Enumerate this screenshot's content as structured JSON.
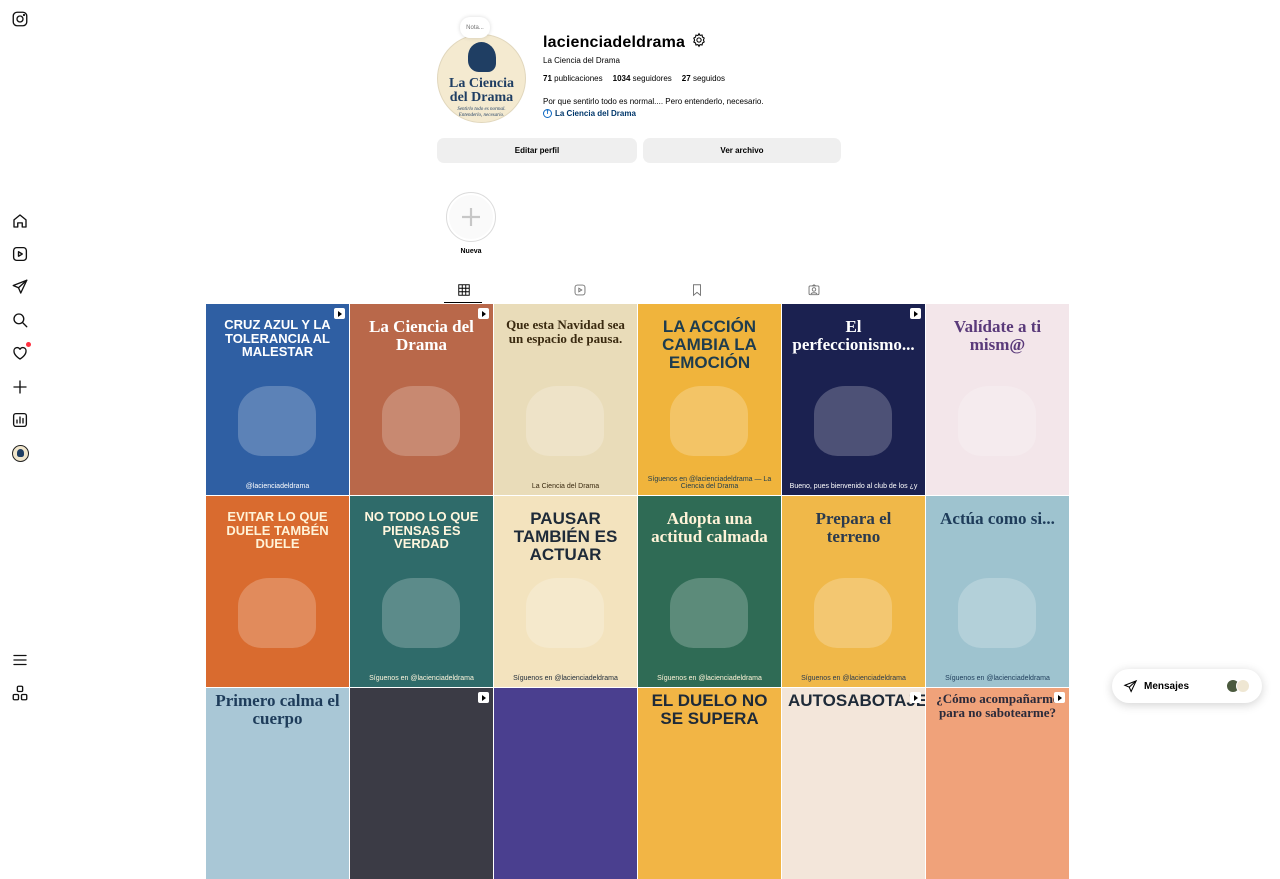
{
  "profile": {
    "note": "Nota...",
    "username": "lacienciadeldrama",
    "full_name": "La Ciencia del Drama",
    "stats": {
      "posts_count": "71",
      "posts_label": "publicaciones",
      "followers_count": "1034",
      "followers_label": "seguidores",
      "following_count": "27",
      "following_label": "seguidos"
    },
    "bio": "Por que sentirlo todo es normal.... Pero entenderlo, necesario.",
    "link_text": "La Ciencia del Drama",
    "avatar": {
      "line1": "La Ciencia",
      "line2": "del Drama",
      "tagline": "Sentirlo todo es normal. Entenderlo, necesario."
    },
    "edit_button": "Editar perfil",
    "archive_button": "Ver archivo"
  },
  "highlight": {
    "label": "Nueva"
  },
  "tabs": [
    "posts-grid-icon",
    "reels-icon",
    "saved-icon",
    "tagged-icon"
  ],
  "posts": [
    {
      "caption": "CRUZ AZUL Y LA TOLERANCIA AL MALESTAR",
      "footer": "@lacienciadeldrama",
      "bg": "#2f5fa3",
      "fg": "#ffffff",
      "reel": true
    },
    {
      "caption": "La Ciencia del Drama",
      "footer": "",
      "bg": "#b9684a",
      "fg": "#ffffff",
      "reel": true
    },
    {
      "caption": "Que esta Navidad sea un espacio de pausa.",
      "footer": "La Ciencia del Drama",
      "bg": "#e9dcb9",
      "fg": "#3a2a10",
      "reel": false
    },
    {
      "caption": "LA ACCIÓN CAMBIA LA EMOCIÓN",
      "footer": "Síguenos en @lacienciadeldrama — La Ciencia del Drama",
      "bg": "#f0b43c",
      "fg": "#1e3c4e",
      "reel": false
    },
    {
      "caption": "El perfeccionismo...",
      "footer": "Bueno, pues bienvenido al club de los ¿y",
      "bg": "#1b2150",
      "fg": "#ffffff",
      "reel": true
    },
    {
      "caption": "Valídate a ti mism@",
      "footer": "",
      "bg": "#f3e6ea",
      "fg": "#5a3a7a",
      "reel": false
    },
    {
      "caption": "EVITAR LO QUE DUELE TAMBÉN DUELE",
      "footer": "",
      "bg": "#d96b2f",
      "fg": "#fff3d8",
      "reel": false
    },
    {
      "caption": "NO TODO LO QUE PIENSAS ES VERDAD",
      "footer": "Síguenos en @lacienciadeldrama",
      "bg": "#2f6b6a",
      "fg": "#fff6dd",
      "reel": false
    },
    {
      "caption": "PAUSAR TAMBIÉN ES ACTUAR",
      "footer": "Síguenos en @lacienciadeldrama",
      "bg": "#f3e3be",
      "fg": "#1e2a38",
      "reel": false
    },
    {
      "caption": "Adopta una actitud calmada",
      "footer": "Síguenos en @lacienciadeldrama",
      "bg": "#2f6b55",
      "fg": "#fff3d8",
      "reel": false
    },
    {
      "caption": "Prepara el terreno",
      "footer": "Síguenos en @lacienciadeldrama",
      "bg": "#f0b849",
      "fg": "#2a3a4e",
      "reel": false
    },
    {
      "caption": "Actúa como si...",
      "footer": "Síguenos en @lacienciadeldrama",
      "bg": "#9ec3cf",
      "fg": "#1e3c5a",
      "reel": false
    },
    {
      "caption": "Primero calma el cuerpo",
      "footer": "",
      "bg": "#a9c7d6",
      "fg": "#1e3c5a",
      "reel": false
    },
    {
      "caption": "",
      "footer": "",
      "bg": "#3b3b45",
      "fg": "#ffffff",
      "reel": true
    },
    {
      "caption": "",
      "footer": "",
      "bg": "#4a3f8f",
      "fg": "#ffffff",
      "reel": false
    },
    {
      "caption": "EL DUELO NO SE SUPERA",
      "footer": "",
      "bg": "#f2b545",
      "fg": "#1e2a38",
      "reel": false
    },
    {
      "caption": "AUTOSABOTAJE",
      "footer": "",
      "bg": "#f3e6da",
      "fg": "#1e2a38",
      "reel": true
    },
    {
      "caption": "¿Cómo acompañarme para no sabotearme?",
      "footer": "",
      "bg": "#f0a27a",
      "fg": "#2a2a3a",
      "reel": true
    }
  ],
  "messages": {
    "label": "Mensajes"
  },
  "sidebar": [
    "instagram-logo-icon",
    "home-icon",
    "reels-icon",
    "messages-icon",
    "search-icon",
    "notifications-icon",
    "create-icon",
    "dashboard-icon",
    "profile-avatar",
    "more-menu-icon",
    "also-from-meta-icon"
  ]
}
